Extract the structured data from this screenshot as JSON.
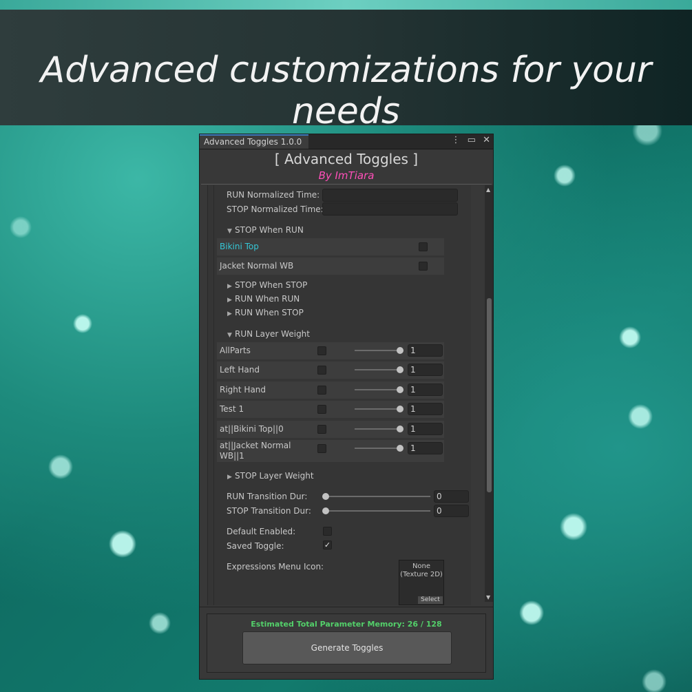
{
  "banner": {
    "text": "Advanced customizations for your needs"
  },
  "window": {
    "tab_title": "Advanced Toggles 1.0.0",
    "header_title": "[ Advanced Toggles ]",
    "header_by": "By ImTiara",
    "colors": {
      "by_color": "#ff4fb9",
      "highlight": "#35c7d6",
      "memory_ok": "#53d06a"
    }
  },
  "fields": {
    "run_norm_label": "RUN Normalized Time:",
    "stop_norm_label": "STOP Normalized Time:",
    "run_norm_value": "",
    "stop_norm_value": ""
  },
  "foldouts": {
    "stop_when_run": "STOP When RUN",
    "stop_when_stop": "STOP When STOP",
    "run_when_run": "RUN When RUN",
    "run_when_stop": "RUN When STOP",
    "run_layer_weight": "RUN Layer Weight",
    "stop_layer_weight": "STOP Layer Weight"
  },
  "stop_when_run_items": [
    {
      "label": "Bikini Top",
      "checked": false
    },
    {
      "label": "Jacket Normal WB",
      "checked": false
    }
  ],
  "layer_weights": [
    {
      "label": "AllParts",
      "checked": false,
      "value": "1",
      "level": 1
    },
    {
      "label": "Left Hand",
      "checked": false,
      "value": "1",
      "level": 1
    },
    {
      "label": "Right Hand",
      "checked": false,
      "value": "1",
      "level": 1
    },
    {
      "label": "Test 1",
      "checked": false,
      "value": "1",
      "level": 1
    },
    {
      "label": "at||Bikini Top||0",
      "checked": false,
      "value": "1",
      "level": 1
    },
    {
      "label": "at||Jacket Normal WB||1",
      "checked": false,
      "value": "1",
      "level": 1
    }
  ],
  "transitions": {
    "run_label": "RUN Transition Dur:",
    "run_value": "0",
    "stop_label": "STOP Transition Dur:",
    "stop_value": "0"
  },
  "options": {
    "default_enabled_label": "Default Enabled:",
    "default_enabled": false,
    "saved_toggle_label": "Saved Toggle:",
    "saved_toggle": true,
    "menu_icon_label": "Expressions Menu Icon:",
    "texture_none": "None",
    "texture_type": "(Texture 2D)",
    "texture_select": "Select"
  },
  "footer": {
    "memory_text": "Estimated Total Parameter Memory: 26 / 128",
    "generate_label": "Generate Toggles"
  },
  "icons": [
    "kebab-menu-icon",
    "maximize-icon",
    "close-icon",
    "scroll-up-icon",
    "scroll-down-icon",
    "foldout-collapsed-icon",
    "foldout-expanded-icon",
    "checkmark-icon"
  ]
}
